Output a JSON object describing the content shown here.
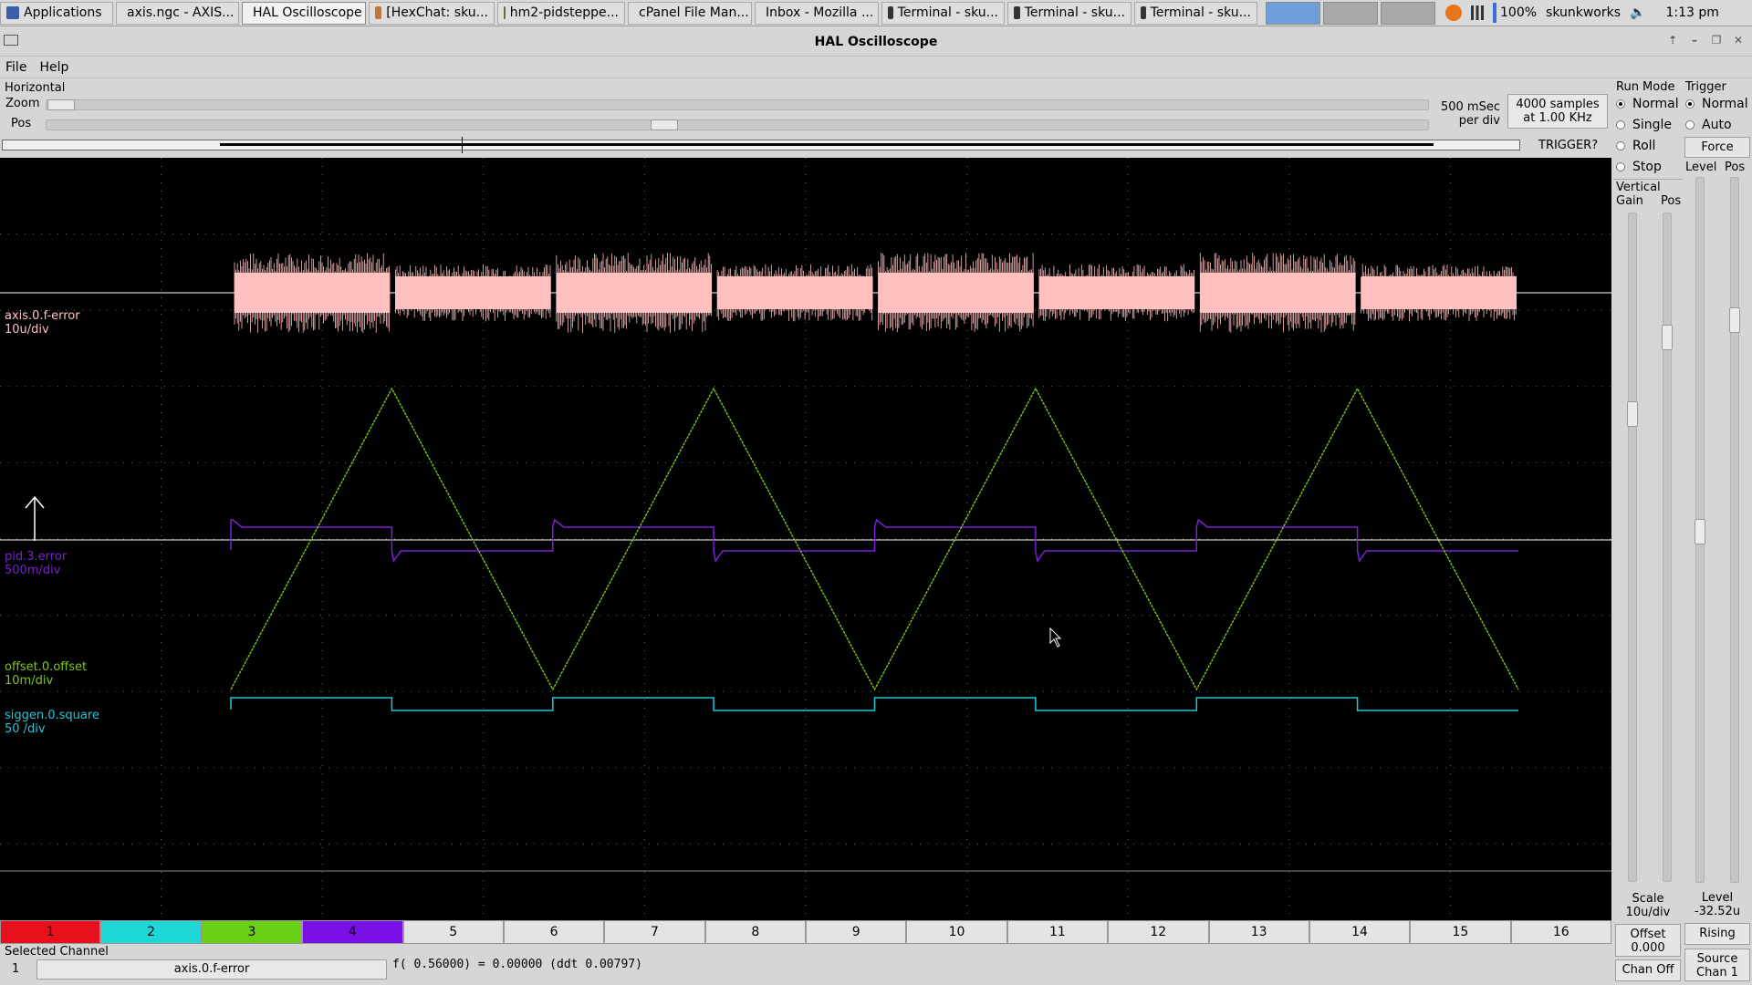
{
  "taskbar": {
    "items": [
      {
        "label": "Applications",
        "icon": "applications-icon"
      },
      {
        "label": "axis.ngc - AXIS...",
        "icon": "axis-icon"
      },
      {
        "label": "HAL Oscilloscope",
        "icon": "window-icon"
      },
      {
        "label": "[HexChat: sku...",
        "icon": "hexchat-icon"
      },
      {
        "label": "hm2-pidsteppe...",
        "icon": "editor-icon"
      },
      {
        "label": "cPanel File Man...",
        "icon": "chrome-icon"
      },
      {
        "label": "Inbox - Mozilla ...",
        "icon": "thunderbird-icon"
      },
      {
        "label": "Terminal - sku...",
        "icon": "terminal-icon"
      },
      {
        "label": "Terminal - sku...",
        "icon": "terminal-icon"
      },
      {
        "label": "Terminal - sku...",
        "icon": "terminal-icon"
      }
    ],
    "battery": "100%",
    "user": "skunkworks",
    "clock": "1:13 pm"
  },
  "window": {
    "title": "HAL Oscilloscope"
  },
  "menu": {
    "file": "File",
    "help": "Help"
  },
  "horizontal": {
    "section_title": "Horizontal",
    "zoom_label": "Zoom",
    "pos_label": "Pos",
    "rate_line1": "500 mSec",
    "rate_line2": "per div",
    "samples_line1": "4000 samples",
    "samples_line2": "at 1.00 KHz",
    "trigger_status": "TRIGGER?"
  },
  "run_mode": {
    "title": "Run Mode",
    "options": [
      "Normal",
      "Single",
      "Roll",
      "Stop"
    ],
    "selected": "Normal"
  },
  "trigger": {
    "title": "Trigger",
    "options": [
      "Normal",
      "Auto"
    ],
    "selected": "Normal",
    "force_label": "Force",
    "level_label": "Level",
    "pos_label": "Pos",
    "level_title": "Level",
    "level_value": "-32.52u",
    "edge": "Rising",
    "source_line1": "Source",
    "source_line2": "Chan  1"
  },
  "vertical": {
    "title": "Vertical",
    "gain_label": "Gain",
    "pos_label": "Pos",
    "scale_title": "Scale",
    "scale_value": "10u/div",
    "offset_title": "Offset",
    "offset_value": "0.000",
    "chan_off_label": "Chan Off"
  },
  "channels": [
    {
      "name": "axis.0.f-error",
      "scale": "10u/div",
      "color": "#ffc0c0"
    },
    {
      "name": "pid.3.error",
      "scale": "500m/div",
      "color": "#7a1fd4"
    },
    {
      "name": "offset.0.offset",
      "scale": "10m/div",
      "color": "#7ec61a"
    },
    {
      "name": "siggen.0.square",
      "scale": "50 /div",
      "color": "#20c8d8"
    }
  ],
  "channel_buttons": [
    {
      "label": "1",
      "color": "#e8101c"
    },
    {
      "label": "2",
      "color": "#1ed8d8"
    },
    {
      "label": "3",
      "color": "#6ad016"
    },
    {
      "label": "4",
      "color": "#7a10e8"
    },
    {
      "label": "5",
      "color": ""
    },
    {
      "label": "6",
      "color": ""
    },
    {
      "label": "7",
      "color": ""
    },
    {
      "label": "8",
      "color": ""
    },
    {
      "label": "9",
      "color": ""
    },
    {
      "label": "10",
      "color": ""
    },
    {
      "label": "11",
      "color": ""
    },
    {
      "label": "12",
      "color": ""
    },
    {
      "label": "13",
      "color": ""
    },
    {
      "label": "14",
      "color": ""
    },
    {
      "label": "15",
      "color": ""
    },
    {
      "label": "16",
      "color": ""
    }
  ],
  "selected_channel": {
    "title": "Selected Channel",
    "number": "1",
    "name": "axis.0.f-error",
    "readout": "f( 0.56000) =  0.00000 (ddt  0.00797)"
  }
}
